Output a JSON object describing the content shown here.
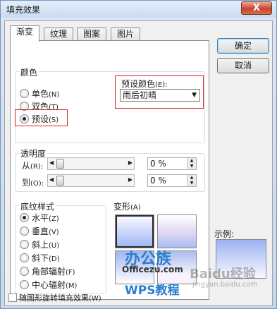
{
  "window": {
    "title": "填充效果",
    "close_label": "X"
  },
  "tabs": [
    {
      "label": "渐变"
    },
    {
      "label": "纹理"
    },
    {
      "label": "图案"
    },
    {
      "label": "图片"
    }
  ],
  "color_group": {
    "label": "颜色",
    "options": [
      {
        "label": "单色",
        "key": "(N)",
        "checked": false
      },
      {
        "label": "双色",
        "key": "(T)",
        "checked": false
      },
      {
        "label": "预设",
        "key": "(S)",
        "checked": true
      }
    ],
    "preset_label": "预设颜色",
    "preset_key": "(E):",
    "preset_value": "雨后初晴"
  },
  "transparency": {
    "label": "透明度",
    "from_label": "从",
    "from_key": "(R):",
    "from_value": "0 %",
    "to_label": "到",
    "to_key": "(O):",
    "to_value": "0 %"
  },
  "shading": {
    "label": "底纹样式",
    "options": [
      {
        "label": "水平",
        "key": "(Z)",
        "checked": true
      },
      {
        "label": "垂直",
        "key": "(V)",
        "checked": false
      },
      {
        "label": "斜上",
        "key": "(U)",
        "checked": false
      },
      {
        "label": "斜下",
        "key": "(D)",
        "checked": false
      },
      {
        "label": "角部辐射",
        "key": "(F)",
        "checked": false
      },
      {
        "label": "中心辐射",
        "key": "(M)",
        "checked": false
      }
    ]
  },
  "variants": {
    "label": "变形",
    "key": "(A)"
  },
  "buttons": {
    "ok": "确定",
    "cancel": "取消"
  },
  "sample": {
    "label": "示例:"
  },
  "rotate_checkbox": {
    "label": "随图形旋转填充效果",
    "key": "(W)",
    "checked": false
  },
  "watermarks": {
    "logo": "办公族",
    "site": "Officezu.com",
    "wps": "WPS教程",
    "baidu": "Baidu经验",
    "baidu_url": "jingyan.baidu.com"
  },
  "colors": {
    "highlight_box": "#d92020",
    "title_close": "#c9442a"
  }
}
